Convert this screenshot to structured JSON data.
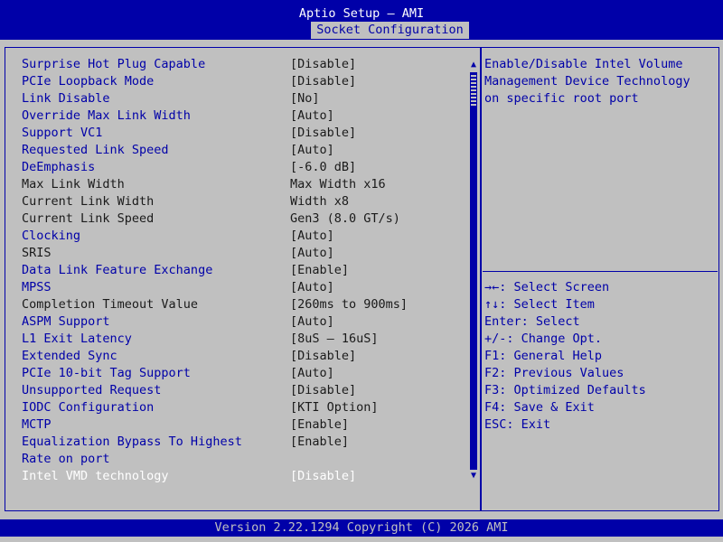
{
  "header": {
    "app_title": "Aptio Setup – AMI",
    "active_tab": "Socket Configuration"
  },
  "settings": [
    {
      "label": "Surprise Hot Plug Capable",
      "value": "[Disable]",
      "editable": true
    },
    {
      "label": "PCIe Loopback Mode",
      "value": "[Disable]",
      "editable": true
    },
    {
      "label": "Link Disable",
      "value": "[No]",
      "editable": true
    },
    {
      "label": "Override Max Link Width",
      "value": "[Auto]",
      "editable": true
    },
    {
      "label": "Support VC1",
      "value": "[Disable]",
      "editable": true
    },
    {
      "label": "Requested Link Speed",
      "value": "[Auto]",
      "editable": true
    },
    {
      "label": "DeEmphasis",
      "value": "[-6.0 dB]",
      "editable": true
    },
    {
      "label": "Max Link Width",
      "value": "Max Width x16",
      "editable": false
    },
    {
      "label": "Current Link Width",
      "value": "Width x8",
      "editable": false
    },
    {
      "label": "Current Link Speed",
      "value": "Gen3 (8.0 GT/s)",
      "editable": false
    },
    {
      "label": "Clocking",
      "value": "[Auto]",
      "editable": true
    },
    {
      "label": "SRIS",
      "value": "[Auto]",
      "editable": false
    },
    {
      "label": "Data Link Feature Exchange",
      "value": "[Enable]",
      "editable": true
    },
    {
      "label": "MPSS",
      "value": "[Auto]",
      "editable": true
    },
    {
      "label": "Completion Timeout Value",
      "value": "[260ms to 900ms]",
      "editable": false
    },
    {
      "label": "ASPM Support",
      "value": "[Auto]",
      "editable": true
    },
    {
      "label": "L1 Exit Latency",
      "value": "[8uS – 16uS]",
      "editable": true
    },
    {
      "label": "Extended Sync",
      "value": "[Disable]",
      "editable": true
    },
    {
      "label": "PCIe 10-bit Tag Support",
      "value": "[Auto]",
      "editable": true
    },
    {
      "label": "Unsupported Request",
      "value": "[Disable]",
      "editable": true
    },
    {
      "label": "IODC Configuration",
      "value": "[KTI Option]",
      "editable": true
    },
    {
      "label": "MCTP",
      "value": "[Enable]",
      "editable": true
    },
    {
      "label": "Equalization Bypass To Highest",
      "value": "[Enable]",
      "editable": true
    },
    {
      "label": "Rate on port",
      "value": "",
      "editable": true
    },
    {
      "label": "Intel VMD technology",
      "value": "[Disable]",
      "editable": true,
      "selected": true
    }
  ],
  "help": {
    "lines": [
      "Enable/Disable Intel Volume",
      "Management Device Technology",
      "on specific root port"
    ]
  },
  "keys": [
    "→←: Select Screen",
    "↑↓: Select Item",
    "Enter: Select",
    "+/-: Change Opt.",
    "F1: General Help",
    "F2: Previous Values",
    "F3: Optimized Defaults",
    "F4: Save & Exit",
    "ESC: Exit"
  ],
  "footer": {
    "text": "Version 2.22.1294 Copyright (C) 2026 AMI"
  },
  "scroll": {
    "up_icon": "▲",
    "down_icon": "▼"
  },
  "colors": {
    "accent_blue": "#0000a8",
    "background_gray": "#c0c0c0",
    "selected_white": "#ffffff"
  }
}
